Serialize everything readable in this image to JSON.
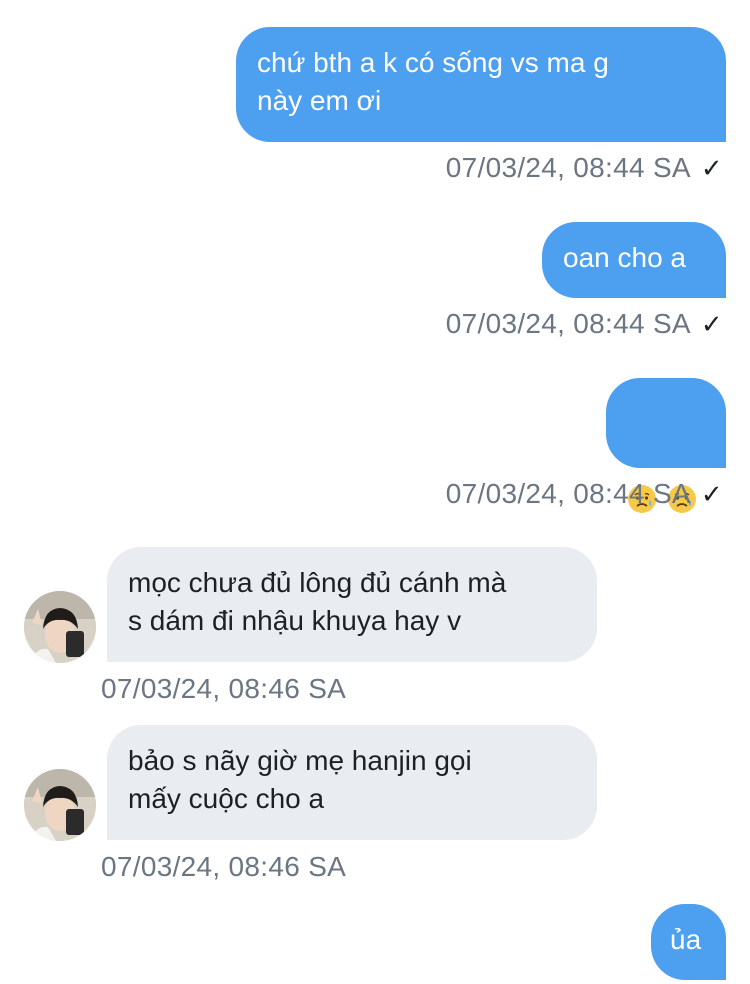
{
  "messages": [
    {
      "direction": "outgoing",
      "text": "chứ bth a k có sống vs ma g\nnày em ơi",
      "time": "07/03/24, 08:44 SA",
      "status_icon": "check-icon",
      "status": "✓"
    },
    {
      "direction": "outgoing",
      "text": "oan cho a",
      "time": "07/03/24, 08:44 SA",
      "status_icon": "check-icon",
      "status": "✓"
    },
    {
      "direction": "outgoing",
      "emoji": [
        "sad-relieved-face-icon",
        "sad-relieved-face-icon"
      ],
      "time": "07/03/24, 08:44 SA",
      "status_icon": "check-icon",
      "status": "✓"
    },
    {
      "direction": "incoming",
      "text": "mọc chưa đủ lông đủ cánh mà\ns dám đi nhậu khuya hay v",
      "time": "07/03/24, 08:46 SA"
    },
    {
      "direction": "incoming",
      "text": "bảo s nãy giờ mẹ hanjin gọi\nmấy cuộc cho a",
      "time": "07/03/24, 08:46 SA"
    },
    {
      "direction": "outgoing",
      "text": "ủa"
    }
  ],
  "colors": {
    "outgoing_bubble": "#4d9ff0",
    "incoming_bubble": "#e9ecf0",
    "timestamp": "#6b7683"
  }
}
